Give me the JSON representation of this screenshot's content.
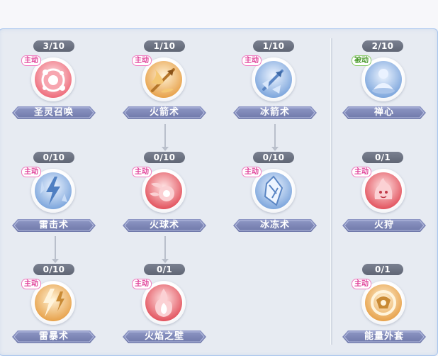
{
  "tag_labels": {
    "active": "主动",
    "passive": "被动"
  },
  "skills": {
    "shengling": {
      "name": "圣灵召唤",
      "level": "3/10",
      "tag": "主动",
      "icon": "summon-orb-icon"
    },
    "huojian": {
      "name": "火箭术",
      "level": "1/10",
      "tag": "主动",
      "icon": "fire-arrow-icon"
    },
    "bingjian": {
      "name": "冰箭术",
      "level": "1/10",
      "tag": "主动",
      "icon": "ice-arrow-icon"
    },
    "chanxin": {
      "name": "禅心",
      "level": "2/10",
      "tag": "被动",
      "icon": "meditation-icon"
    },
    "leiji": {
      "name": "雷击术",
      "level": "0/10",
      "tag": "主动",
      "icon": "lightning-icon"
    },
    "huoqiu": {
      "name": "火球术",
      "level": "0/10",
      "tag": "主动",
      "icon": "fireball-icon"
    },
    "bingdong": {
      "name": "冰冻术",
      "level": "0/10",
      "tag": "主动",
      "icon": "ice-crystal-icon"
    },
    "huoshou": {
      "name": "火狩",
      "level": "0/1",
      "tag": "主动",
      "icon": "fire-beast-icon"
    },
    "leibao": {
      "name": "雷暴术",
      "level": "0/10",
      "tag": "主动",
      "icon": "thunderstorm-icon"
    },
    "huoyan": {
      "name": "火焰之壁",
      "level": "0/1",
      "tag": "主动",
      "icon": "fire-wall-icon"
    },
    "nengliang": {
      "name": "能量外套",
      "level": "0/1",
      "tag": "主动",
      "icon": "energy-coat-icon"
    }
  },
  "colors": {
    "nameplate": "#7f88b8",
    "active_tag": "#e0439a",
    "passive_tag": "#4a9a2c",
    "level_badge": "#6b7180"
  }
}
